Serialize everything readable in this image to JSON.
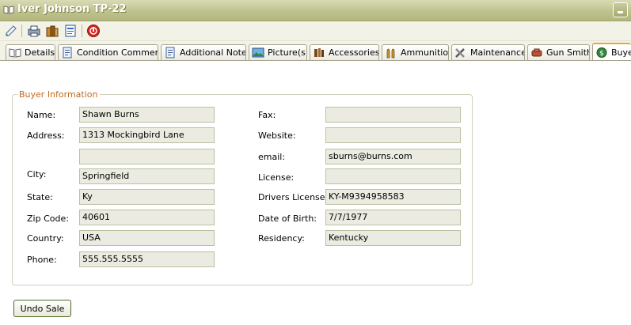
{
  "window": {
    "title": "Iver Johnson TP-22"
  },
  "toolbar": {
    "buttons": [
      "edit-icon",
      "print-icon",
      "books-icon",
      "report-icon",
      "close-icon"
    ]
  },
  "tabs": [
    {
      "label": "Details",
      "icon": "book-icon"
    },
    {
      "label": "Condition Comments",
      "icon": "notes-icon"
    },
    {
      "label": "Additional Notes",
      "icon": "notes-icon"
    },
    {
      "label": "Picture(s)",
      "icon": "picture-icon"
    },
    {
      "label": "Accessories",
      "icon": "accessories-icon"
    },
    {
      "label": "Ammunition",
      "icon": "ammunition-icon"
    },
    {
      "label": "Maintenance",
      "icon": "tools-icon"
    },
    {
      "label": "Gun Smith",
      "icon": "gunsmith-icon"
    },
    {
      "label": "Buyer",
      "icon": "buyer-icon",
      "active": true
    }
  ],
  "buyer": {
    "legend": "Buyer Information",
    "labels": {
      "name": "Name:",
      "address": "Address:",
      "city": "City:",
      "state": "State:",
      "zip": "Zip Code:",
      "country": "Country:",
      "phone": "Phone:",
      "fax": "Fax:",
      "website": "Website:",
      "email": "email:",
      "license": "License:",
      "drivers_license": "Drivers License:",
      "dob": "Date of Birth:",
      "residency": "Residency:"
    },
    "values": {
      "name": "Shawn Burns",
      "address1": "1313 Mockingbird Lane",
      "address2": "",
      "city": "Springfield",
      "state": "Ky",
      "zip": "40601",
      "country": "USA",
      "phone": "555.555.5555",
      "fax": "",
      "website": "",
      "email": "sburns@burns.com",
      "license": "",
      "drivers_license": "KY-M9394958583",
      "dob": "7/7/1977",
      "residency": "Kentucky"
    }
  },
  "actions": {
    "undo_sale": "Undo Sale"
  },
  "colors": {
    "legend": "#c46a1b",
    "active_tab_accent": "#e7a93f",
    "titlebar": "#bfc28e"
  }
}
